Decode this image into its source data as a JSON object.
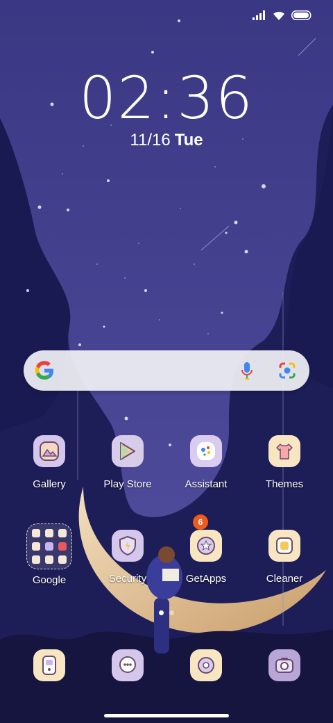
{
  "status_bar": {
    "signal_icon": "signal-bars-icon",
    "wifi_icon": "wifi-icon",
    "battery_icon": "battery-icon"
  },
  "clock": {
    "time": "02:36"
  },
  "date": {
    "date": "11/16",
    "day": "Tue"
  },
  "search": {
    "google_icon": "google-g-icon",
    "mic_icon": "microphone-icon",
    "lens_icon": "google-lens-icon"
  },
  "apps": {
    "gallery": "Gallery",
    "play_store": "Play Store",
    "assistant": "Assistant",
    "themes": "Themes",
    "google": "Google",
    "security": "Security",
    "getapps": "GetApps",
    "getapps_badge": "6",
    "cleaner": "Cleaner"
  },
  "dock": [
    "phone-icon",
    "messaging-icon",
    "browser-icon",
    "camera-icon"
  ],
  "page_indicator": {
    "count": 2,
    "active": 1
  },
  "colors": {
    "sky_top": "#3c3a85",
    "sky_bottom": "#1f1f5c",
    "badge": "#f05a1a",
    "icon_lavender": "#d5c6ec",
    "icon_cream": "#f8e6c2"
  }
}
